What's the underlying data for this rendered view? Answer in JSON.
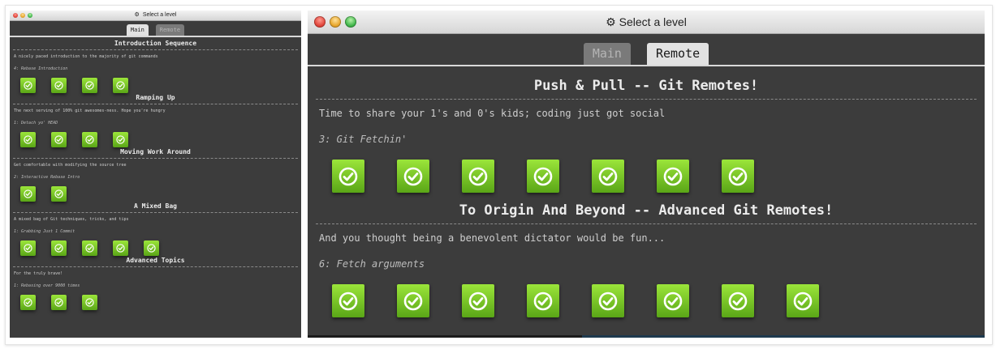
{
  "small_window": {
    "title": "Select a level",
    "tabs": [
      {
        "label": "Main",
        "active": true
      },
      {
        "label": "Remote",
        "active": false
      }
    ],
    "sections": [
      {
        "title": "Introduction Sequence",
        "description": "A nicely paced introduction to the majority of git commands",
        "current_level": "4: Rebase Introduction",
        "levels_completed": 4
      },
      {
        "title": "Ramping Up",
        "description": "The next serving of 100% git awesomes-ness. Hope you're hungry",
        "current_level": "1: Detach yo' HEAD",
        "levels_completed": 4
      },
      {
        "title": "Moving Work Around",
        "description": "Get comfortable with modifying the source tree",
        "current_level": "2: Interactive Rebase Intro",
        "levels_completed": 2
      },
      {
        "title": "A Mixed Bag",
        "description": "A mixed bag of Git techniques, tricks, and tips",
        "current_level": "1: Grabbing Just 1 Commit",
        "levels_completed": 5
      },
      {
        "title": "Advanced Topics",
        "description": "For the truly brave!",
        "current_level": "1: Rebasing over 9000 times",
        "levels_completed": 3
      }
    ]
  },
  "large_window": {
    "title": "Select a level",
    "tabs": [
      {
        "label": "Main",
        "active": false
      },
      {
        "label": "Remote",
        "active": true
      }
    ],
    "sections": [
      {
        "title": "Push & Pull -- Git Remotes!",
        "description": "Time to share your 1's and 0's kids; coding just got social",
        "current_level": "3: Git Fetchin'",
        "levels_completed": 7
      },
      {
        "title": "To Origin And Beyond -- Advanced Git Remotes!",
        "description": "And you thought being a benevolent dictator would be fun...",
        "current_level": "6: Fetch arguments",
        "levels_completed": 8
      }
    ]
  },
  "icons": {
    "settings": "gear-icon",
    "level_done": "checkmark-icon"
  },
  "colors": {
    "window_bg": "#3c3c3c",
    "level_button": "#7ac428",
    "active_tab": "#e2e2e2",
    "inactive_tab": "#7a7a7a"
  }
}
